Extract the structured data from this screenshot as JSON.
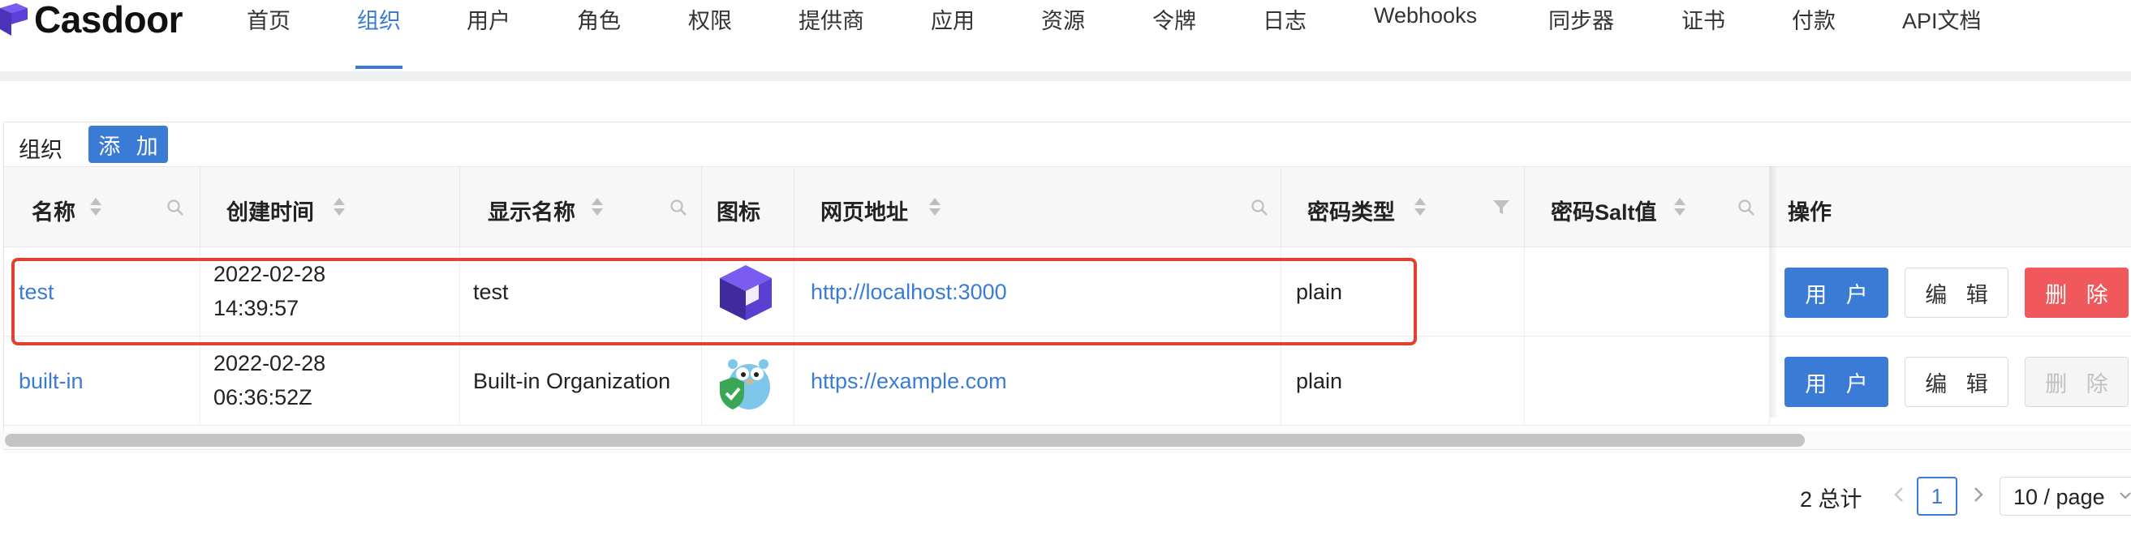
{
  "app": {
    "logo_text": "Casdoor"
  },
  "nav": {
    "items": [
      {
        "label": "首页",
        "active": false
      },
      {
        "label": "组织",
        "active": true
      },
      {
        "label": "用户",
        "active": false
      },
      {
        "label": "角色",
        "active": false
      },
      {
        "label": "权限",
        "active": false
      },
      {
        "label": "提供商",
        "active": false
      },
      {
        "label": "应用",
        "active": false
      },
      {
        "label": "资源",
        "active": false
      },
      {
        "label": "令牌",
        "active": false
      },
      {
        "label": "日志",
        "active": false
      },
      {
        "label": "Webhooks",
        "active": false
      },
      {
        "label": "同步器",
        "active": false
      },
      {
        "label": "证书",
        "active": false
      },
      {
        "label": "付款",
        "active": false
      },
      {
        "label": "API文档",
        "active": false
      }
    ]
  },
  "card": {
    "title": "组织",
    "add_label": "添 加"
  },
  "table": {
    "columns": [
      "名称",
      "创建时间",
      "显示名称",
      "图标",
      "网页地址",
      "密码类型",
      "密码Salt值",
      "操作"
    ],
    "rows": [
      {
        "name": "test",
        "created_date": "2022-02-28",
        "created_time": "14:39:57",
        "display_name": "test",
        "icon": "cube-logo-icon",
        "website": "http://localhost:3000",
        "password_type": "plain",
        "password_salt": "",
        "user_label": "用 户",
        "edit_label": "编 辑",
        "delete_label": "删 除",
        "delete_enabled": true
      },
      {
        "name": "built-in",
        "created_date": "2022-02-28",
        "created_time": "06:36:52Z",
        "display_name": "Built-in Organization",
        "icon": "gopher-shield-icon",
        "website": "https://example.com",
        "password_type": "plain",
        "password_salt": "",
        "user_label": "用 户",
        "edit_label": "编 辑",
        "delete_label": "删 除",
        "delete_enabled": false
      }
    ]
  },
  "pagination": {
    "total_text": "2 总计",
    "current_page": "1",
    "page_size": "10 / page"
  },
  "colors": {
    "accent": "#3a7bd5",
    "danger": "#f0585b",
    "highlight": "#e3402f"
  }
}
